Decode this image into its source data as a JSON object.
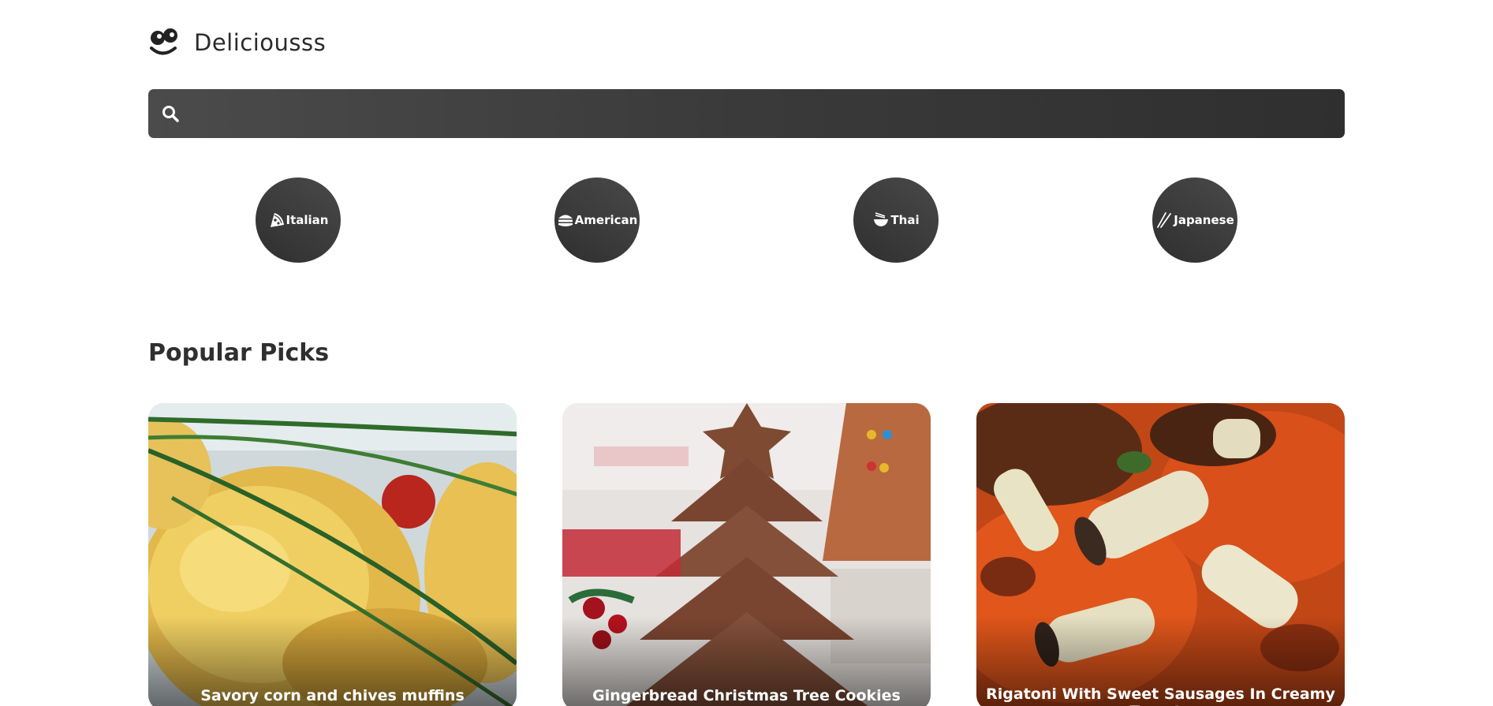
{
  "header": {
    "logo_text": "Deliciousss",
    "logo_icon": "smile-logo-icon"
  },
  "search": {
    "value": "",
    "placeholder": ""
  },
  "cuisines": [
    {
      "label": "Italian",
      "icon": "pizza-icon"
    },
    {
      "label": "American",
      "icon": "hamburger-icon"
    },
    {
      "label": "Thai",
      "icon": "noodle-bowl-icon"
    },
    {
      "label": "Japanese",
      "icon": "chopsticks-icon"
    }
  ],
  "popular": {
    "title": "Popular Picks",
    "cards": [
      {
        "title": "Savory corn and chives muffins"
      },
      {
        "title": "Gingerbread Christmas Tree Cookies"
      },
      {
        "title": "Rigatoni With Sweet Sausages In Creamy Tomato"
      }
    ]
  }
}
